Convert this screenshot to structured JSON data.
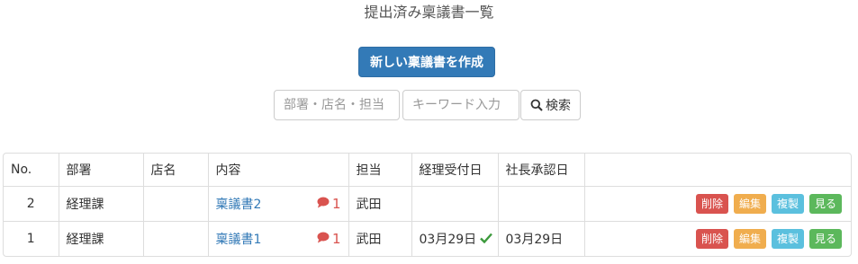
{
  "page": {
    "title": "提出済み稟議書一覧"
  },
  "toolbar": {
    "create_label": "新しい稟議書を作成"
  },
  "search": {
    "dept_placeholder": "部署・店名・担当",
    "keyword_placeholder": "キーワード入力",
    "button_label": "検索"
  },
  "table": {
    "headers": [
      "No.",
      "部署",
      "店名",
      "内容",
      "担当",
      "経理受付日",
      "社長承認日",
      ""
    ],
    "rows": [
      {
        "no": "2",
        "dept": "経理課",
        "store": "",
        "content": "稟議書2",
        "comments": "1",
        "person": "武田",
        "accounting_date": "",
        "accounting_checked": false,
        "president_date": ""
      },
      {
        "no": "1",
        "dept": "経理課",
        "store": "",
        "content": "稟議書1",
        "comments": "1",
        "person": "武田",
        "accounting_date": "03月29日",
        "accounting_checked": true,
        "president_date": "03月29日"
      }
    ],
    "actions": {
      "delete": "削除",
      "edit": "編集",
      "copy": "複製",
      "view": "見る"
    }
  },
  "colors": {
    "primary": "#337ab7",
    "danger": "#d9534f",
    "warning": "#f0ad4e",
    "info": "#5bc0de",
    "success": "#5cb85c"
  },
  "icons": {
    "search": "search-icon",
    "comment": "comment-icon",
    "check": "check-icon"
  }
}
